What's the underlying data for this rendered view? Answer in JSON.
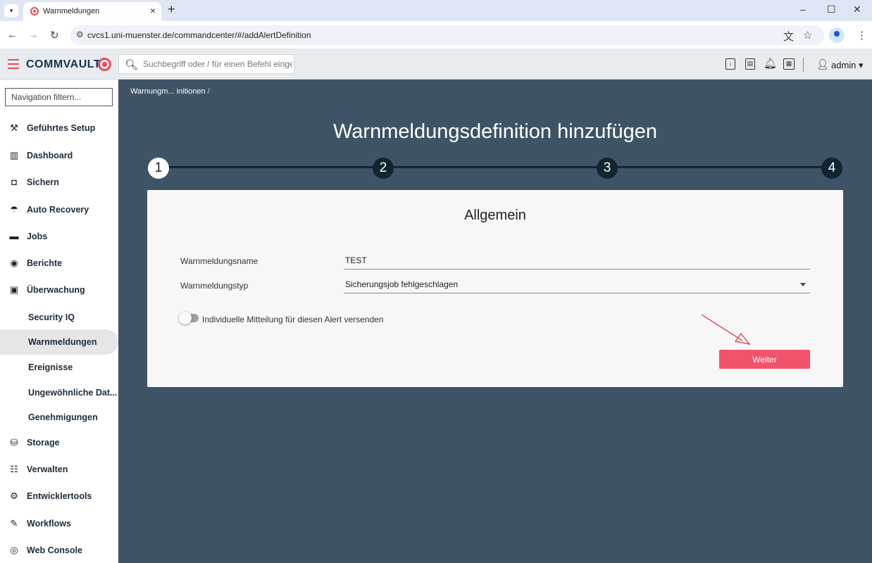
{
  "browser": {
    "tab_title": "Warnmeldungen",
    "url": "cvcs1.uni-muenster.de/commandcenter/#/addAlertDefinition"
  },
  "header": {
    "brand": "COMMVAULT",
    "search_placeholder": "Suchbegriff oder / für einen Befehl eingeben",
    "user": "admin"
  },
  "sidebar": {
    "filter_placeholder": "Navigation filtern...",
    "items": [
      {
        "label": "Geführtes Setup",
        "icon": "wrench-icon"
      },
      {
        "label": "Dashboard",
        "icon": "chart-icon"
      },
      {
        "label": "Sichern",
        "icon": "shield-icon"
      },
      {
        "label": "Auto Recovery",
        "icon": "recovery-icon"
      },
      {
        "label": "Jobs",
        "icon": "briefcase-icon"
      },
      {
        "label": "Berichte",
        "icon": "report-icon"
      },
      {
        "label": "Überwachung",
        "icon": "monitor-icon"
      },
      {
        "label": "Security IQ",
        "sub": true
      },
      {
        "label": "Warnmeldungen",
        "sub": true,
        "active": true
      },
      {
        "label": "Ereignisse",
        "sub": true
      },
      {
        "label": "Ungewöhnliche Dat...",
        "sub": true
      },
      {
        "label": "Genehmigungen",
        "sub": true
      },
      {
        "label": "Storage",
        "icon": "database-icon"
      },
      {
        "label": "Verwalten",
        "icon": "sliders-icon"
      },
      {
        "label": "Entwicklertools",
        "icon": "gear-icon"
      },
      {
        "label": "Workflows",
        "icon": "workflow-icon"
      },
      {
        "label": "Web Console",
        "icon": "globe-icon"
      }
    ]
  },
  "main": {
    "breadcrumb": "Warnungm... initionen",
    "breadcrumb_sep": "/",
    "title": "Warnmeldungsdefinition hinzufügen",
    "steps": [
      "1",
      "2",
      "3",
      "4"
    ],
    "card": {
      "title": "Allgemein",
      "name_label": "Warnmeldungsname",
      "name_value": "TEST",
      "type_label": "Warnmeldungstyp",
      "type_value": "Sicherungsjob fehlgeschlagen",
      "toggle_label": "Individuelle Mitteilung für diesen Alert versenden",
      "next_button": "Weiter"
    }
  },
  "colors": {
    "accent": "#f0536a",
    "main_bg": "#3e5466",
    "step_dark": "#102434"
  }
}
